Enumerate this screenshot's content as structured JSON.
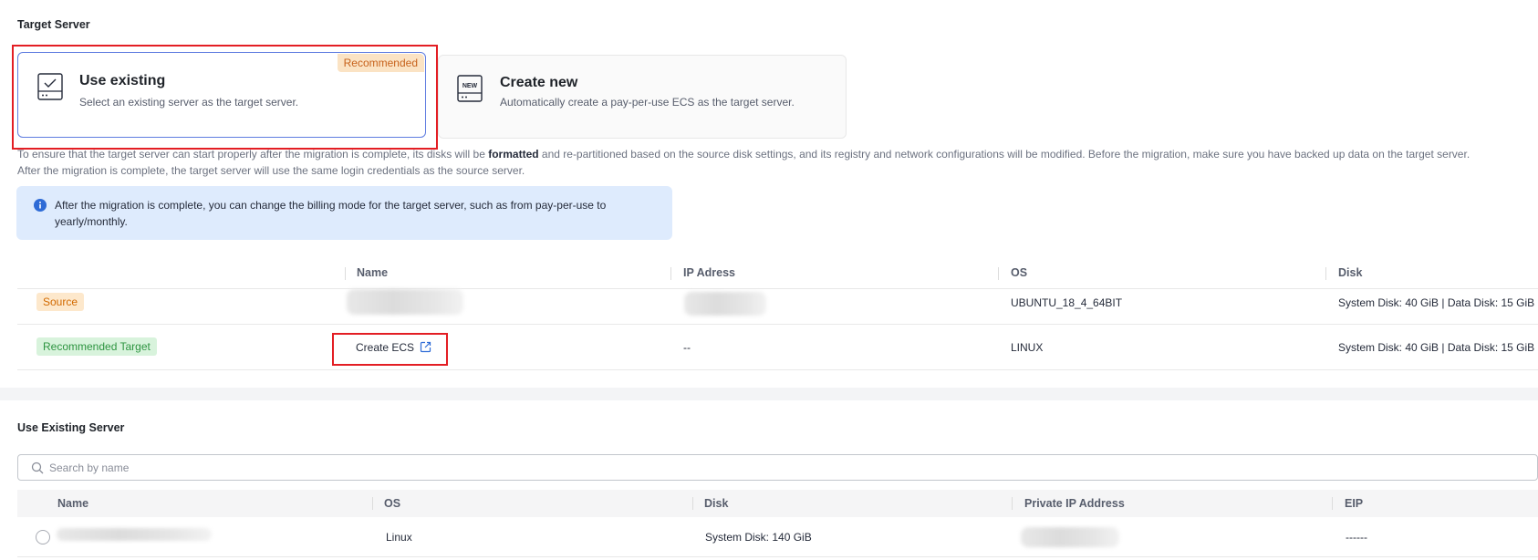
{
  "target_server": {
    "title": "Target Server",
    "use_existing": {
      "title": "Use existing",
      "description": "Select an existing server as the target server.",
      "badge": "Recommended"
    },
    "create_new": {
      "title": "Create new",
      "description": "Automatically create a pay-per-use ECS as the target server.",
      "icon_text": "NEW"
    },
    "note_line1_a": "To ensure that the target server can start properly after the migration is complete, its disks will be ",
    "note_line1_bold": "formatted",
    "note_line1_b": " and re-partitioned based on the source disk settings, and its registry and network configurations will be modified. Before the migration, make sure you have backed up data on the target server.",
    "note_line2": "After the migration is complete, the target server will use the same login credentials as the source server.",
    "info": "After the migration is complete, you can change the billing mode for the target server, such as from pay-per-use to yearly/monthly."
  },
  "comparison_table": {
    "columns": [
      "Name",
      "IP Adress",
      "OS",
      "Disk"
    ],
    "rows": [
      {
        "tag": "Source",
        "name": "",
        "ip": "",
        "os": "UBUNTU_18_4_64BIT",
        "disk": "System Disk: 40 GiB | Data Disk: 15 GiB"
      },
      {
        "tag": "Recommended Target",
        "name": "Create ECS",
        "ip": "--",
        "os": "LINUX",
        "disk": "System Disk: 40 GiB | Data Disk: 15 GiB"
      }
    ]
  },
  "use_existing_server": {
    "title": "Use Existing Server",
    "search_placeholder": "Search by name",
    "columns": [
      "Name",
      "OS",
      "Disk",
      "Private IP Address",
      "EIP"
    ],
    "rows": [
      {
        "name": "",
        "os": "Linux",
        "disk": "System Disk: 140 GiB",
        "private_ip": "",
        "eip": "------"
      }
    ]
  },
  "colors": {
    "accent": "#5e7ce0",
    "highlight": "#e31e24",
    "link": "#2e6bd6",
    "info_bg": "#deebfd"
  },
  "icons": [
    "server-check-icon",
    "new-server-icon",
    "info-icon",
    "external-link-icon",
    "search-icon"
  ]
}
